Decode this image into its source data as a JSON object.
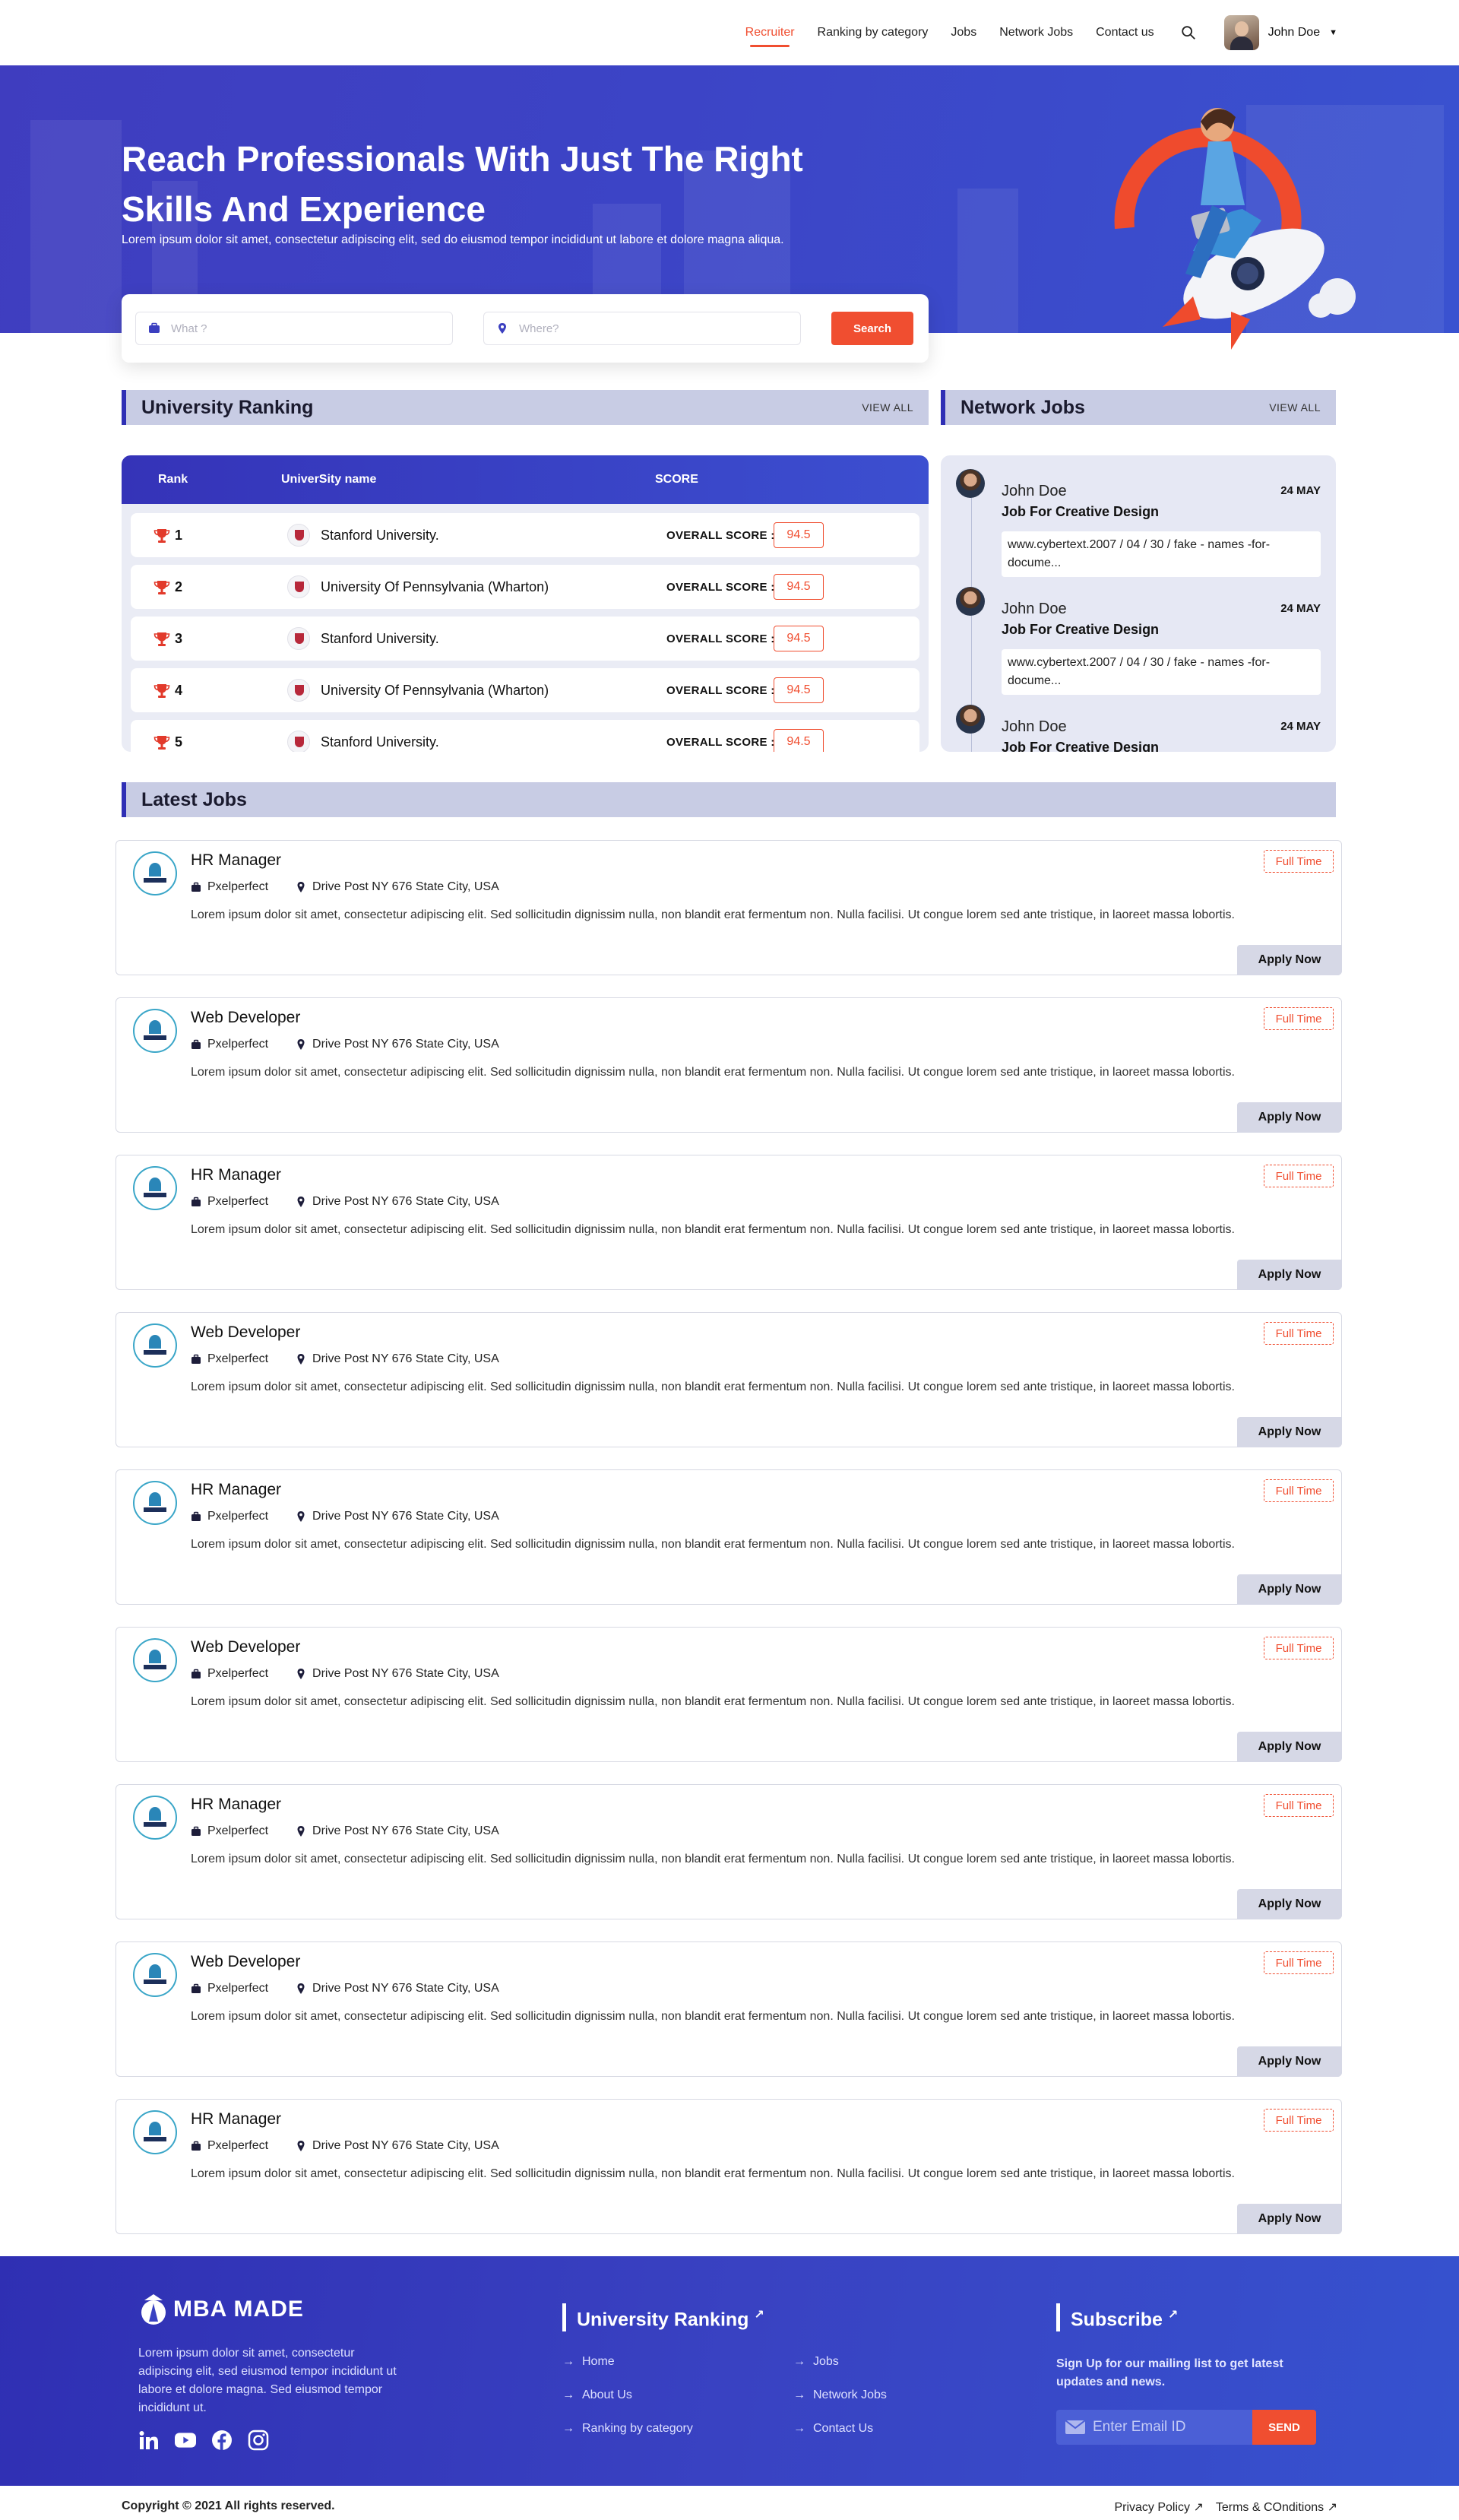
{
  "nav": {
    "links": [
      "Recruiter",
      "Ranking by category",
      "Jobs",
      "Network Jobs",
      "Contact us"
    ],
    "active_index": 0,
    "user_name": "John Doe"
  },
  "hero": {
    "title": "Reach Professionals With Just The Right Skills And Experience",
    "subtitle": "Lorem ipsum dolor sit amet, consectetur adipiscing elit, sed do eiusmod tempor incididunt ut labore et dolore magna aliqua.",
    "what_placeholder": "What ?",
    "where_placeholder": "Where?",
    "search_label": "Search"
  },
  "ranking": {
    "title": "University Ranking",
    "view_all": "VIEW ALL",
    "col_rank": "Rank",
    "col_name": "UniverSity name",
    "col_score": "SCORE",
    "score_label": "OVERALL SCORE :",
    "rows": [
      {
        "rank": "1",
        "name": "Stanford University.",
        "score": "94.5"
      },
      {
        "rank": "2",
        "name": "University Of Pennsylvania (Wharton)",
        "score": "94.5"
      },
      {
        "rank": "3",
        "name": "Stanford University.",
        "score": "94.5"
      },
      {
        "rank": "4",
        "name": "University Of Pennsylvania (Wharton)",
        "score": "94.5"
      },
      {
        "rank": "5",
        "name": "Stanford University.",
        "score": "94.5"
      }
    ]
  },
  "network": {
    "title": "Network Jobs",
    "view_all": "VIEW ALL",
    "items": [
      {
        "name": "John Doe",
        "date": "24 MAY",
        "job": "Job For Creative Design",
        "link": "www.cybertext.2007 / 04 / 30 / fake - names -for-docume..."
      },
      {
        "name": "John Doe",
        "date": "24 MAY",
        "job": "Job For Creative Design",
        "link": "www.cybertext.2007 / 04 / 30 / fake - names -for-docume..."
      },
      {
        "name": "John Doe",
        "date": "24 MAY",
        "job": "Job For Creative Design",
        "link": ""
      }
    ]
  },
  "latest": {
    "title": "Latest Jobs",
    "jobs": [
      {
        "title": "HR Manager",
        "company": "Pxelperfect",
        "location": "Drive Post NY 676 State City, USA",
        "desc": "Lorem ipsum dolor sit amet, consectetur adipiscing elit. Sed sollicitudin dignissim nulla, non blandit erat fermentum non. Nulla facilisi. Ut congue lorem sed ante tristique, in laoreet massa lobortis.",
        "type": "Full Time",
        "apply": "Apply Now"
      },
      {
        "title": "Web Developer",
        "company": "Pxelperfect",
        "location": "Drive Post NY 676 State City, USA",
        "desc": "Lorem ipsum dolor sit amet, consectetur adipiscing elit. Sed sollicitudin dignissim nulla, non blandit erat fermentum non. Nulla facilisi. Ut congue lorem sed ante tristique, in laoreet massa lobortis.",
        "type": "Full Time",
        "apply": "Apply Now"
      },
      {
        "title": "HR Manager",
        "company": "Pxelperfect",
        "location": "Drive Post NY 676 State City, USA",
        "desc": "Lorem ipsum dolor sit amet, consectetur adipiscing elit. Sed sollicitudin dignissim nulla, non blandit erat fermentum non. Nulla facilisi. Ut congue lorem sed ante tristique, in laoreet massa lobortis.",
        "type": "Full Time",
        "apply": "Apply Now"
      },
      {
        "title": "Web Developer",
        "company": "Pxelperfect",
        "location": "Drive Post NY 676 State City, USA",
        "desc": "Lorem ipsum dolor sit amet, consectetur adipiscing elit. Sed sollicitudin dignissim nulla, non blandit erat fermentum non. Nulla facilisi. Ut congue lorem sed ante tristique, in laoreet massa lobortis.",
        "type": "Full Time",
        "apply": "Apply Now"
      },
      {
        "title": "HR Manager",
        "company": "Pxelperfect",
        "location": "Drive Post NY 676 State City, USA",
        "desc": "Lorem ipsum dolor sit amet, consectetur adipiscing elit. Sed sollicitudin dignissim nulla, non blandit erat fermentum non. Nulla facilisi. Ut congue lorem sed ante tristique, in laoreet massa lobortis.",
        "type": "Full Time",
        "apply": "Apply Now"
      },
      {
        "title": "Web Developer",
        "company": "Pxelperfect",
        "location": "Drive Post NY 676 State City, USA",
        "desc": "Lorem ipsum dolor sit amet, consectetur adipiscing elit. Sed sollicitudin dignissim nulla, non blandit erat fermentum non. Nulla facilisi. Ut congue lorem sed ante tristique, in laoreet massa lobortis.",
        "type": "Full Time",
        "apply": "Apply Now"
      },
      {
        "title": "HR Manager",
        "company": "Pxelperfect",
        "location": "Drive Post NY 676 State City, USA",
        "desc": "Lorem ipsum dolor sit amet, consectetur adipiscing elit. Sed sollicitudin dignissim nulla, non blandit erat fermentum non. Nulla facilisi. Ut congue lorem sed ante tristique, in laoreet massa lobortis.",
        "type": "Full Time",
        "apply": "Apply Now"
      },
      {
        "title": "Web Developer",
        "company": "Pxelperfect",
        "location": "Drive Post NY 676 State City, USA",
        "desc": "Lorem ipsum dolor sit amet, consectetur adipiscing elit. Sed sollicitudin dignissim nulla, non blandit erat fermentum non. Nulla facilisi. Ut congue lorem sed ante tristique, in laoreet massa lobortis.",
        "type": "Full Time",
        "apply": "Apply Now"
      },
      {
        "title": "HR Manager",
        "company": "Pxelperfect",
        "location": "Drive Post NY 676 State City, USA",
        "desc": "Lorem ipsum dolor sit amet, consectetur adipiscing elit. Sed sollicitudin dignissim nulla, non blandit erat fermentum non. Nulla facilisi. Ut congue lorem sed ante tristique, in laoreet massa lobortis.",
        "type": "Full Time",
        "apply": "Apply Now"
      }
    ]
  },
  "footer": {
    "brand": "MBA MADE",
    "about": "Lorem ipsum dolor sit amet, consectetur adipiscing elit, sed eiusmod tempor incididunt ut labore et dolore magna. Sed eiusmod tempor incididunt ut.",
    "social_icons": [
      "linkedin-icon",
      "youtube-icon",
      "facebook-icon",
      "instagram-icon"
    ],
    "ranking_title": "University Ranking",
    "links_col1": [
      "Home",
      "About Us",
      "Ranking by category"
    ],
    "links_col2": [
      "Jobs",
      "Network Jobs",
      "Contact Us"
    ],
    "subscribe_title": "Subscribe",
    "subscribe_text": "Sign Up for our mailing list to get latest updates and news.",
    "email_placeholder": "Enter Email ID",
    "send_label": "SEND",
    "copyright": "Copyright © 2021 All rights reserved.",
    "privacy": "Privacy Policy ↗",
    "terms": "Terms & COnditions ↗"
  },
  "colors": {
    "primary": "#3a3fc0",
    "accent": "#f04e30",
    "section_bg": "#c8cce4"
  }
}
